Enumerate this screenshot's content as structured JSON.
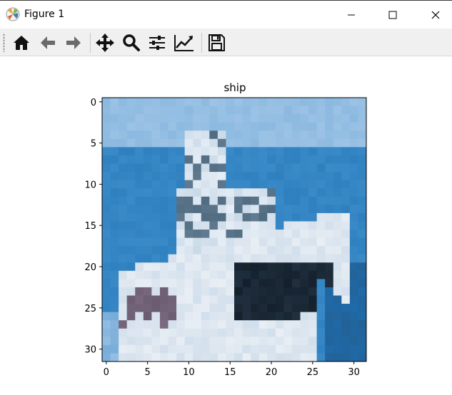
{
  "window": {
    "title": "Figure 1",
    "controls": [
      "minimize",
      "maximize",
      "close"
    ]
  },
  "toolbar": {
    "tools": [
      {
        "name": "home-button",
        "icon": "home-icon"
      },
      {
        "name": "back-button",
        "icon": "arrow-left-icon"
      },
      {
        "name": "forward-button",
        "icon": "arrow-right-icon"
      },
      {
        "name": "pan-button",
        "icon": "move-icon"
      },
      {
        "name": "zoom-button",
        "icon": "magnifier-icon"
      },
      {
        "name": "subplots-button",
        "icon": "sliders-icon"
      },
      {
        "name": "edit-axes-button",
        "icon": "line-chart-icon"
      },
      {
        "name": "save-button",
        "icon": "floppy-disk-icon"
      }
    ]
  },
  "chart_data": {
    "type": "heatmap",
    "title": "ship",
    "xlabel": "",
    "ylabel": "",
    "xlim": [
      -0.5,
      31.5
    ],
    "ylim": [
      31.5,
      -0.5
    ],
    "x_ticks": [
      "0",
      "5",
      "10",
      "15",
      "20",
      "25",
      "30"
    ],
    "y_ticks": [
      "0",
      "5",
      "10",
      "15",
      "20",
      "25",
      "30"
    ],
    "grid": false,
    "image_size": [
      32,
      32
    ],
    "description_colors": {
      "sky": "#8cb9e0",
      "sea": "#2f80bf",
      "deep_sea": "#1f6aa8",
      "hull_white": "#e8eef4",
      "shadow": "#14202c"
    }
  }
}
